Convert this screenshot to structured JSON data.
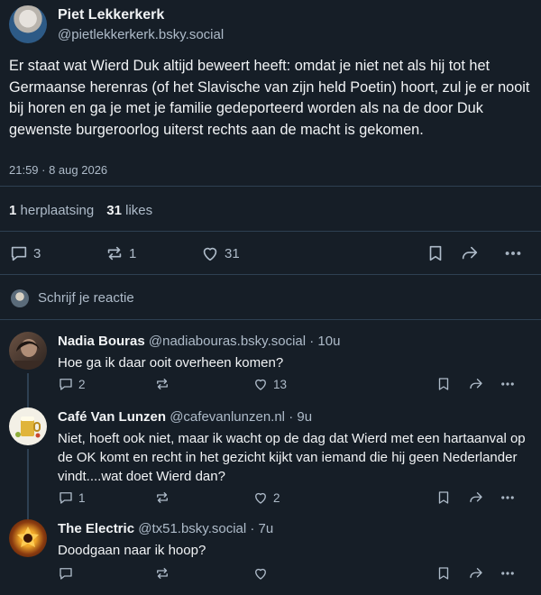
{
  "post": {
    "author_name": "Piet Lekkerkerk",
    "author_handle": "@pietlekkerkerk.bsky.social",
    "text": "Er staat wat Wierd Duk altijd beweert heeft: omdat je niet net als hij tot het Germaanse herenras (of het Slavische van zijn held Poetin) hoort, zul je er nooit bij horen en ga je met je familie gedeporteerd worden als na de door Duk gewenste burgeroorlog uiterst rechts aan de macht is gekomen.",
    "timestamp": "21:59 · 8 aug 2026",
    "reposts_count": "1",
    "reposts_label": "herplaatsing",
    "likes_count": "31",
    "likes_label": "likes",
    "actions": {
      "replies": "3",
      "reposts": "1",
      "likes": "31"
    }
  },
  "reply_prompt": "Schrijf je reactie",
  "comments": [
    {
      "name": "Nadia Bouras",
      "handle": "@nadiabouras.bsky.social",
      "time": "· 10u",
      "text": "Hoe ga ik daar ooit overheen komen?",
      "replies": "2",
      "reposts": "",
      "likes": "13"
    },
    {
      "name": "Café Van Lunzen",
      "handle": "@cafevanlunzen.nl",
      "time": "· 9u",
      "text": "Niet, hoeft ook niet, maar ik wacht op de dag dat Wierd met een hartaanval op de OK komt en recht in het gezicht kijkt van iemand die hij geen Nederlander vindt....wat doet Wierd dan?",
      "replies": "1",
      "reposts": "",
      "likes": "2"
    },
    {
      "name": "The Electric",
      "handle": "@tx51.bsky.social",
      "time": "· 7u",
      "text": "Doodgaan naar ik hoop?",
      "replies": "",
      "reposts": "",
      "likes": ""
    }
  ],
  "icons": {
    "reply": "comment-bubble-icon",
    "repost": "repost-arrows-icon",
    "like": "heart-icon",
    "bookmark": "bookmark-icon",
    "share": "share-arrow-icon",
    "more": "more-dots-icon"
  },
  "colors": {
    "background": "#161e27",
    "text": "#f1f3f5",
    "muted": "#aebbc9",
    "divider": "#2e4052"
  }
}
